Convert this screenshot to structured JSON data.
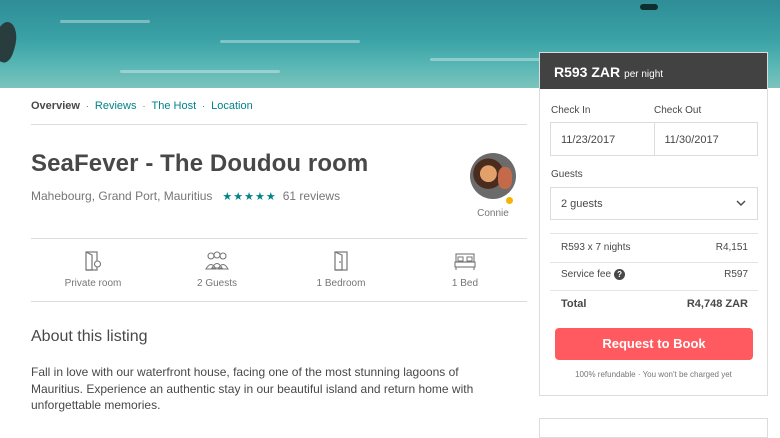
{
  "nav": {
    "items": [
      {
        "label": "Overview"
      },
      {
        "label": "Reviews"
      },
      {
        "label": "The Host"
      },
      {
        "label": "Location"
      }
    ]
  },
  "listing": {
    "title": "SeaFever - The Doudou room",
    "location": "Mahebourg, Grand Port, Mauritius",
    "stars": "★★★★★",
    "rating": 5,
    "reviews": "61 reviews"
  },
  "host": {
    "name": "Connie"
  },
  "amenities": [
    {
      "label": "Private room",
      "icon": "door-icon"
    },
    {
      "label": "2 Guests",
      "icon": "guests-icon"
    },
    {
      "label": "1 Bedroom",
      "icon": "bedroom-door-icon"
    },
    {
      "label": "1 Bed",
      "icon": "bed-icon"
    }
  ],
  "about": {
    "heading": "About this listing",
    "description": "Fall in love with our waterfront house, facing one of the most stunning lagoons of Mauritius. Experience an authentic stay in our beautiful island and return home with unforgettable memories."
  },
  "booking": {
    "price": "R593 ZAR",
    "per": "per night",
    "check_in_label": "Check In",
    "check_out_label": "Check Out",
    "check_in": "11/23/2017",
    "check_out": "11/30/2017",
    "guests_label": "Guests",
    "guests": "2 guests",
    "nights_label": "R593 x 7 nights",
    "nights_value": "R4,151",
    "fee_label": "Service fee",
    "fee_help": "?",
    "fee_value": "R597",
    "total_label": "Total",
    "total_value": "R4,748 ZAR",
    "button": "Request to Book",
    "fine_print": "100% refundable · You won't be charged yet"
  },
  "colors": {
    "accent": "#008489",
    "button": "#ff5a5f",
    "price_bar": "#424242"
  }
}
